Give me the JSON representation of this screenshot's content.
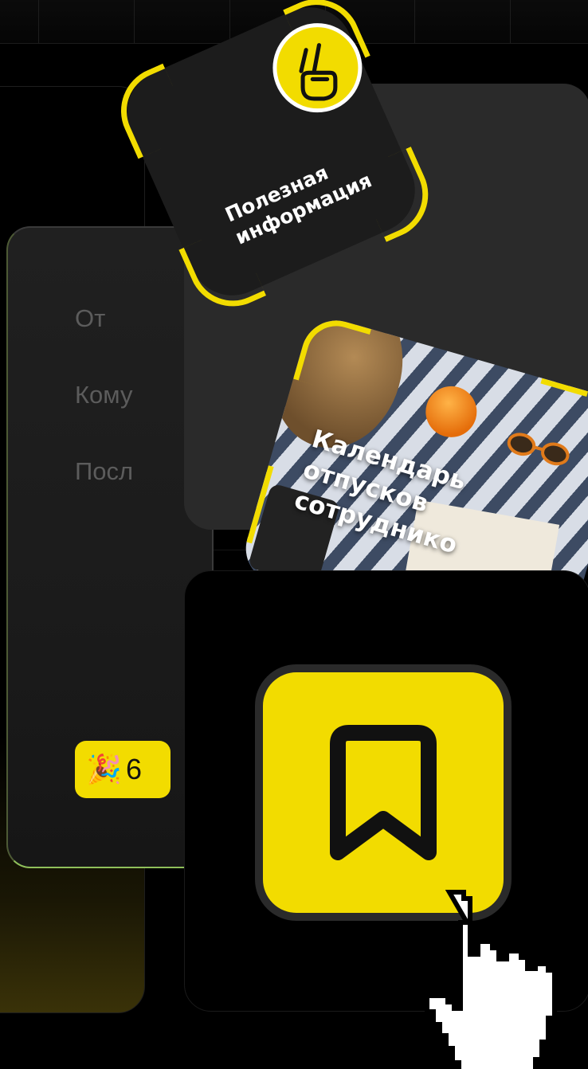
{
  "form": {
    "from_label": "От",
    "to_label": "Кому",
    "message_label": "Посл",
    "chip_text": "6"
  },
  "cards": {
    "useful_info_line1": "Полезная",
    "useful_info_line2": "информация",
    "vacation_line1": "Календарь",
    "vacation_line2": "отпусков",
    "vacation_line3": "сотруднико"
  },
  "icons": {
    "victory": "victory-hand-icon",
    "bookmark": "bookmark-icon",
    "cursor": "pointer-hand-cursor-icon",
    "confetti": "party-popper-icon",
    "confetti_glyph": "🎉"
  },
  "colors": {
    "accent": "#f2dc00",
    "background": "#000000",
    "panel": "#2a2a2a",
    "card": "#1c1c1c"
  }
}
